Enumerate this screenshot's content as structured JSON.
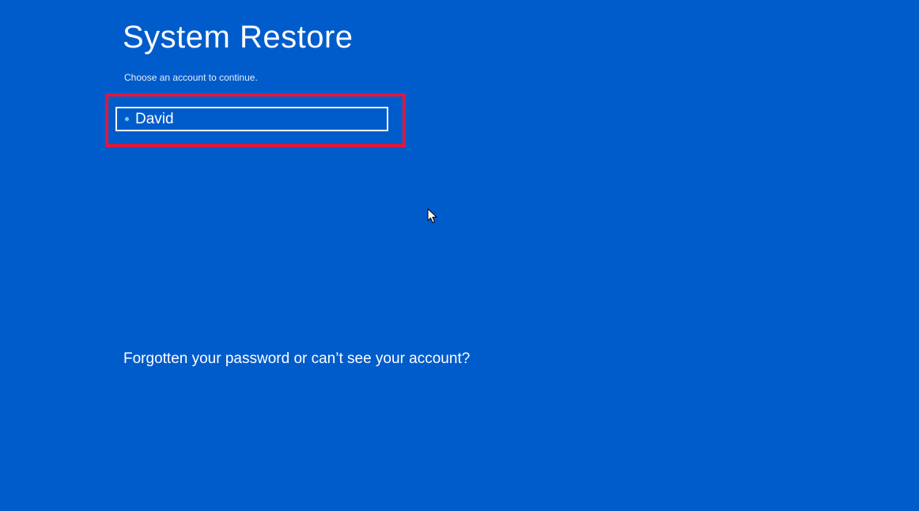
{
  "page": {
    "title": "System Restore",
    "subtitle": "Choose an account to continue."
  },
  "accounts": [
    {
      "name": "David",
      "icon": "bullet-dot-icon"
    }
  ],
  "links": {
    "forgot": "Forgotten your password or can’t see your account?"
  },
  "colors": {
    "background": "#005ccb",
    "text": "#ffffff",
    "highlight_box": "#e0173a",
    "bullet": "#7fc8ff"
  },
  "icons": {
    "pointer": "mouse-pointer-icon",
    "account_bullet": "bullet-dot-icon"
  }
}
